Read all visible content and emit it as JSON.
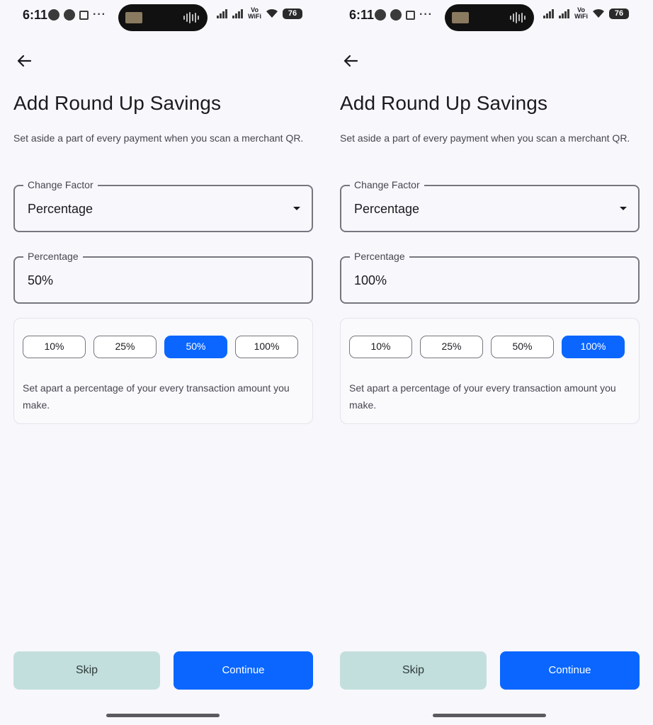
{
  "screens": [
    {
      "status": {
        "time": "6:11",
        "vowifi": "Vo\nWiFi",
        "battery": "76"
      },
      "title": "Add Round Up Savings",
      "subtitle": "Set aside a part of every payment when you scan a merchant QR.",
      "change_factor": {
        "label": "Change Factor",
        "value": "Percentage"
      },
      "percentage": {
        "label": "Percentage",
        "value": "50%"
      },
      "chips": [
        {
          "label": "10%",
          "selected": false
        },
        {
          "label": "25%",
          "selected": false
        },
        {
          "label": "50%",
          "selected": true
        },
        {
          "label": "100%",
          "selected": false
        }
      ],
      "card_text": "Set apart a percentage of your every transaction amount you make.",
      "skip_label": "Skip",
      "continue_label": "Continue"
    },
    {
      "status": {
        "time": "6:11",
        "vowifi": "Vo\nWiFi",
        "battery": "76"
      },
      "title": "Add Round Up Savings",
      "subtitle": "Set aside a part of every payment when you scan a merchant QR.",
      "change_factor": {
        "label": "Change Factor",
        "value": "Percentage"
      },
      "percentage": {
        "label": "Percentage",
        "value": "100%"
      },
      "chips": [
        {
          "label": "10%",
          "selected": false
        },
        {
          "label": "25%",
          "selected": false
        },
        {
          "label": "50%",
          "selected": false
        },
        {
          "label": "100%",
          "selected": true
        }
      ],
      "card_text": "Set apart a percentage of your every transaction amount you make.",
      "skip_label": "Skip",
      "continue_label": "Continue"
    }
  ],
  "colors": {
    "accent": "#0a66ff",
    "skip_bg": "#c3dfdd",
    "background": "#f8f7fc"
  },
  "icons": [
    "arrow-left-icon",
    "dropdown-arrow-icon",
    "signal-icon",
    "wifi-icon",
    "battery-icon"
  ]
}
